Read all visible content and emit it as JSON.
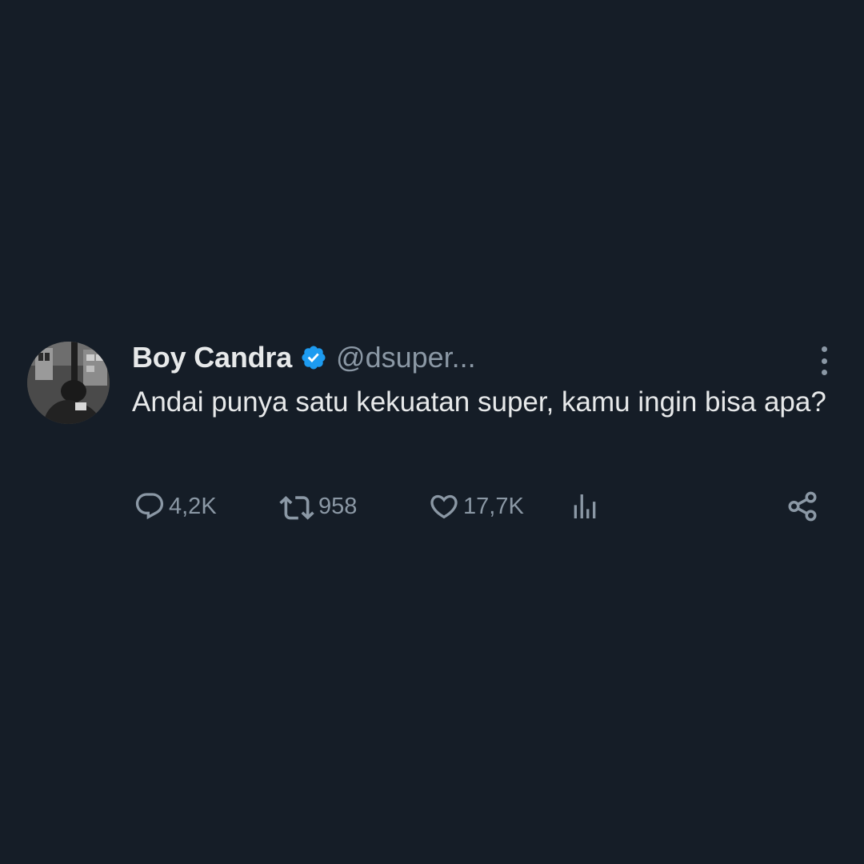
{
  "tweet": {
    "author": {
      "display_name": "Boy Candra",
      "handle": "@dsuper...",
      "verified": true,
      "avatar_icon": "profile-photo-grayscale"
    },
    "text": "Andai punya satu kekuatan super, kamu ingin bisa apa?",
    "actions": {
      "replies": "4,2K",
      "retweets": "958",
      "likes": "17,7K"
    }
  },
  "colors": {
    "background": "#151d27",
    "text_primary": "#e7e9ea",
    "text_secondary": "#8b98a5",
    "verified_badge": "#1d9bf0"
  },
  "icons": {
    "reply": "reply-icon",
    "retweet": "retweet-icon",
    "like": "heart-icon",
    "views": "views-chart-icon",
    "share": "share-icon",
    "more": "more-options-icon"
  }
}
